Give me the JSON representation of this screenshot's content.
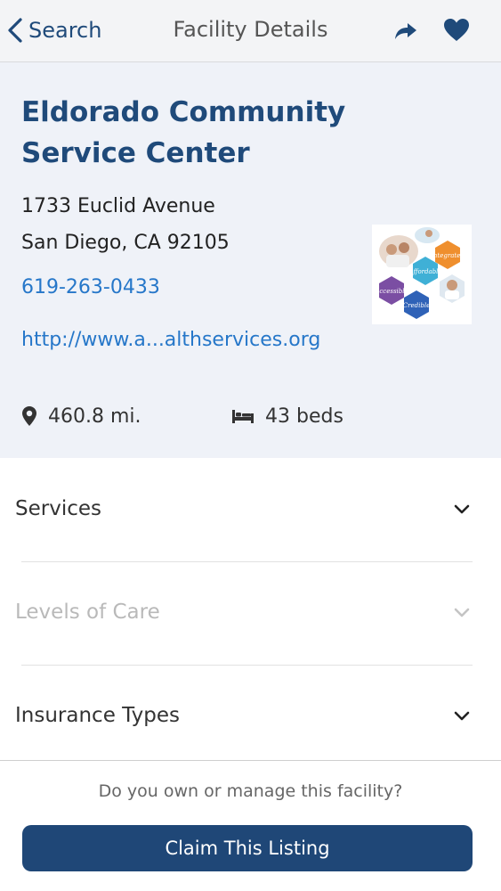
{
  "nav": {
    "back_label": "Search",
    "title": "Facility Details",
    "share_icon": "share-arrow-icon",
    "favorite_icon": "heart-icon"
  },
  "facility": {
    "name_line1": "Eldorado Community",
    "name_line2": "Service Center",
    "address_line1": "1733 Euclid Avenue",
    "address_line2": "San Diego, CA 92105",
    "phone": "619-263-0433",
    "website": "http://www.a...althservices.org",
    "logo_words": [
      "Integrated",
      "Affordable",
      "Accessible",
      "Credible"
    ],
    "distance": "460.8 mi.",
    "beds": "43 beds",
    "distance_icon": "location-pin-icon",
    "beds_icon": "bed-icon"
  },
  "sections": [
    {
      "label": "Services",
      "enabled": true
    },
    {
      "label": "Levels of Care",
      "enabled": false
    },
    {
      "label": "Insurance Types",
      "enabled": true
    }
  ],
  "claim": {
    "question": "Do you own or manage this facility?",
    "button_label": "Claim This Listing"
  },
  "colors": {
    "brand": "#1f4a7a",
    "link": "#2677c9",
    "header_bg": "#eff2f8",
    "button_bg": "#1f4777",
    "disabled_text": "#b9b9b9"
  }
}
